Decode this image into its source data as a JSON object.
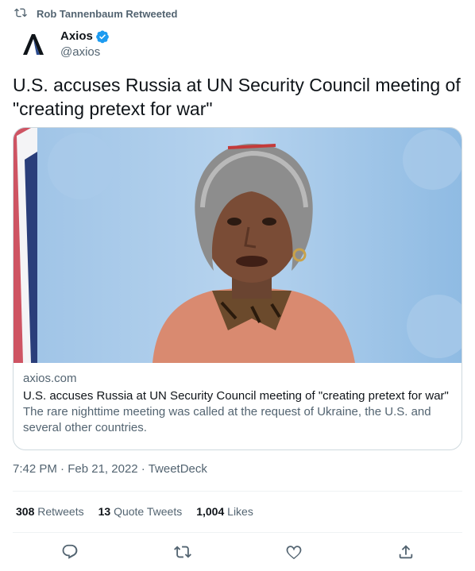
{
  "retweet": {
    "label": "Rob Tannenbaum Retweeted"
  },
  "author": {
    "name": "Axios",
    "handle": "@axios"
  },
  "tweet": {
    "text": "U.S. accuses Russia at UN Security Council meeting of \"creating pretext for war\""
  },
  "card": {
    "domain": "axios.com",
    "title": "U.S. accuses Russia at UN Security Council meeting of \"creating pretext for war\"",
    "description": "The rare nighttime meeting was called at the request of Ukraine, the U.S. and several other countries."
  },
  "meta": {
    "time": "7:42 PM",
    "date": "Feb 21, 2022",
    "source": "TweetDeck",
    "sep": "·"
  },
  "stats": {
    "retweets_count": "308",
    "retweets_label": "Retweets",
    "quotes_count": "13",
    "quotes_label": "Quote Tweets",
    "likes_count": "1,004",
    "likes_label": "Likes"
  },
  "icons": {
    "retweet": "retweet-icon",
    "verified": "verified-badge-icon",
    "reply": "reply-icon",
    "like": "heart-icon",
    "share": "share-icon"
  },
  "colors": {
    "verified": "#1d9bf0",
    "secondary_text": "#536471"
  }
}
